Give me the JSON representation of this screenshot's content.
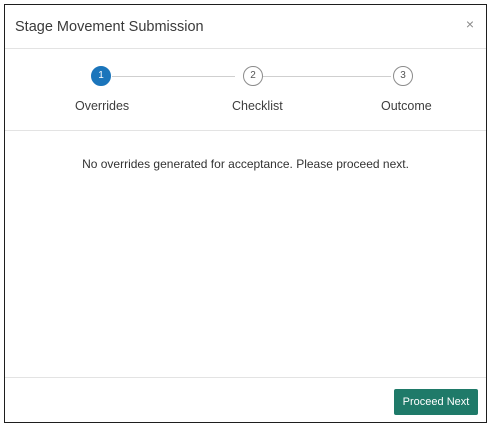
{
  "dialog": {
    "title": "Stage Movement Submission",
    "close_icon": "close-icon",
    "close_glyph": "×"
  },
  "stepper": {
    "steps": [
      {
        "number": "1",
        "label": "Overrides",
        "state": "active"
      },
      {
        "number": "2",
        "label": "Checklist",
        "state": "inactive"
      },
      {
        "number": "3",
        "label": "Outcome",
        "state": "inactive"
      }
    ]
  },
  "content": {
    "message": "No overrides generated for acceptance. Please proceed next."
  },
  "footer": {
    "proceed_label": "Proceed Next"
  },
  "colors": {
    "active_step": "#1b75bb",
    "primary_button": "#1f7a69",
    "border": "#1e1e1e",
    "divider": "#e3e3e3"
  }
}
